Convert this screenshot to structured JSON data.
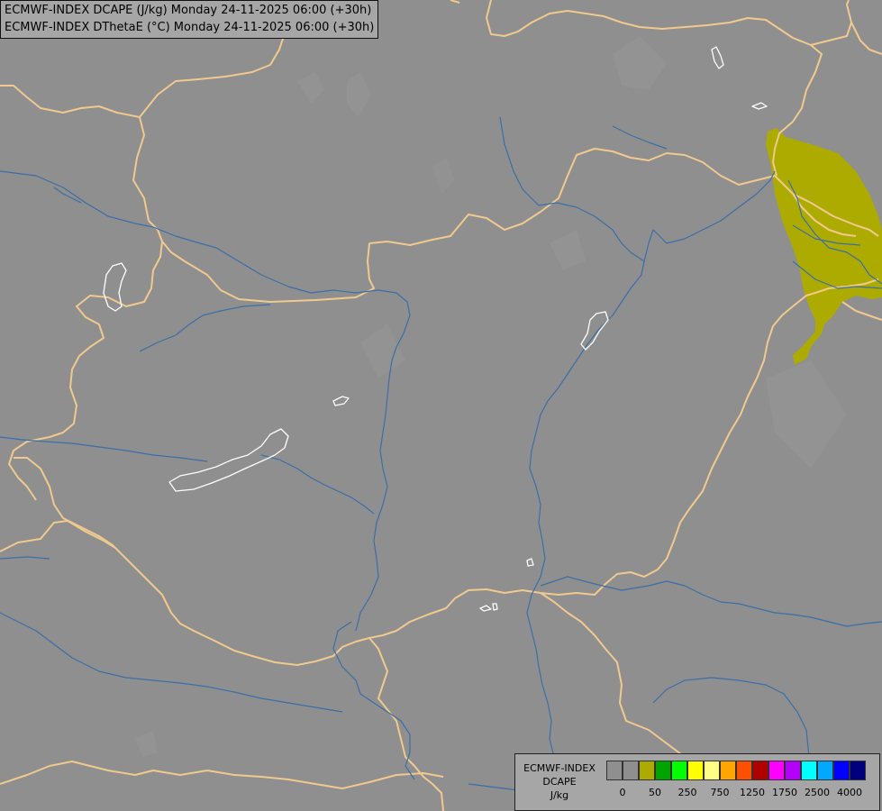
{
  "header": {
    "line1": "ECMWF-INDEX DCAPE (J/kg) Monday 24-11-2025 06:00 (+30h)",
    "line2": "ECMWF-INDEX DThetaE (°C) Monday 24-11-2025 06:00 (+30h)"
  },
  "map_colors": {
    "background": "#8f8f8f",
    "border": "#f0c98f",
    "river": "#3b6fa6",
    "lake_outline": "#ffffff",
    "dcape_fill": "#adab00"
  },
  "legend": {
    "title_line1": "ECMWF-INDEX",
    "title_line2": "DCAPE",
    "title_line3": "J/kg",
    "colors": [
      "#8f8f8f",
      "#8f8f8f",
      "#adab00",
      "#00a400",
      "#00ff00",
      "#ffff00",
      "#ffff86",
      "#ffa500",
      "#ff4f00",
      "#b00000",
      "#ff00ff",
      "#b400ff",
      "#00ffff",
      "#00a8ff",
      "#0000ff",
      "#00007f"
    ],
    "tick_labels": [
      "0",
      "50",
      "250",
      "750",
      "1250",
      "1750",
      "2500",
      "4000"
    ]
  }
}
